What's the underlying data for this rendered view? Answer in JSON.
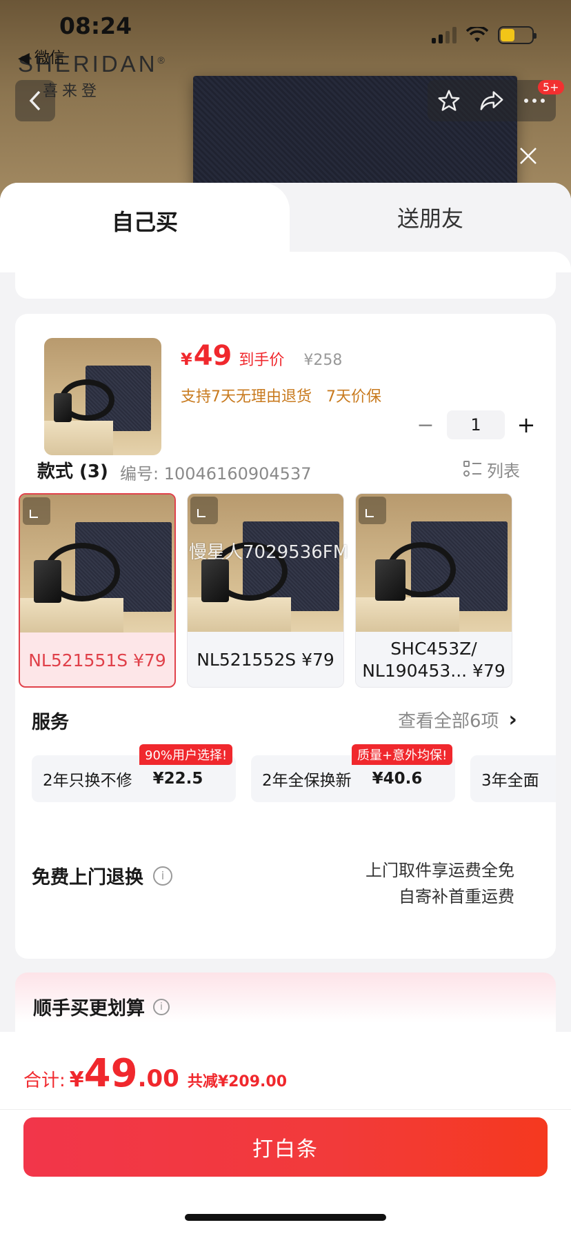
{
  "status_bar": {
    "time": "08:24",
    "back_app": "◀ 微信"
  },
  "brand": {
    "en": "SHERIDAN",
    "reg": "®",
    "cn": "喜来登"
  },
  "header": {
    "cart_badge": "5+"
  },
  "tabs": [
    {
      "label": "自己买"
    },
    {
      "label": "送朋友"
    }
  ],
  "product": {
    "price_symbol": "¥",
    "price": "49",
    "price_tag": "到手价",
    "original_price": "¥258",
    "return_policy": "支持7天无理由退货   7天价保",
    "quantity": "1"
  },
  "styles": {
    "title": "款式 (3)",
    "code": "编号: 10046160904537",
    "list_label": "列表",
    "variants": [
      {
        "label": "NL521551S ¥79",
        "selected": true
      },
      {
        "label": "NL521552S ¥79",
        "selected": false
      },
      {
        "label": "SHC453Z/ NL190453... ¥79",
        "selected": false
      }
    ],
    "watermark": "慢星人7029536FM"
  },
  "services": {
    "title": "服务",
    "view_all": "查看全部6项",
    "items": [
      {
        "name": "2年只换不修",
        "price": "¥22.5",
        "badge": "90%用户选择!"
      },
      {
        "name": "2年全保换新",
        "price": "¥40.6",
        "badge": "质量+意外均保!"
      },
      {
        "name": "3年全面",
        "price": "",
        "badge": ""
      }
    ]
  },
  "return_service": {
    "title": "免费上门退换",
    "desc_line1": "上门取件享运费全免",
    "desc_line2": "自寄补首重运费"
  },
  "bundle": {
    "title": "顺手买更划算"
  },
  "footer": {
    "total_label": "合计:",
    "total_symbol": "¥",
    "total_int": "49",
    "total_dec": ".00",
    "savings": "共减¥209.00",
    "pay_button": "打白条"
  },
  "colors": {
    "accent": "#f0282d",
    "gold": "#c87a1e",
    "selected_bg": "#fde6e8"
  }
}
